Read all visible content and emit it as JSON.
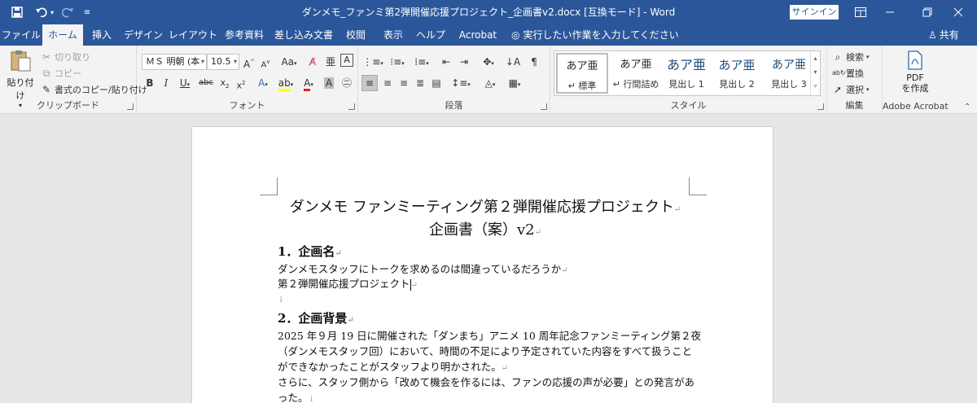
{
  "titlebar": {
    "save_icon": "save-icon",
    "undo_icon": "undo-icon",
    "redo_icon": "redo-icon",
    "customize_icon": "customize-qat-icon",
    "title": "ダンメモ_ファンミ第2弾開催応援プロジェクト_企画書v2.docx [互換モード]  -  Word",
    "signin": "サインイン",
    "ribbon_display_icon": "ribbon-display-icon",
    "minimize_icon": "minimize-icon",
    "restore_icon": "restore-icon",
    "close_icon": "close-icon",
    "accent": "#2b579a"
  },
  "tabs": [
    "ファイル",
    "ホーム",
    "挿入",
    "デザイン",
    "レイアウト",
    "参考資料",
    "差し込み文書",
    "校閲",
    "表示",
    "ヘルプ",
    "Acrobat"
  ],
  "active_tab": "ホーム",
  "tellme": "実行したい作業を入力してください",
  "share": "共有",
  "ribbon": {
    "clipboard": {
      "label": "クリップボード",
      "paste": "貼り付け",
      "cut": "切り取り",
      "copy": "コピー",
      "format_painter": "書式のコピー/貼り付け"
    },
    "font": {
      "label": "フォント",
      "font_name": "ＭＳ 明朝 (本",
      "font_size": "10.5"
    },
    "paragraph": {
      "label": "段落"
    },
    "styles": {
      "label": "スタイル",
      "items": [
        {
          "sample": "あア亜",
          "name": "標準"
        },
        {
          "sample": "あア亜",
          "name": "行間詰め"
        },
        {
          "sample": "あア亜",
          "name": "見出し 1"
        },
        {
          "sample": "あア亜",
          "name": "見出し 2"
        },
        {
          "sample": "あア亜",
          "name": "見出し 3"
        }
      ]
    },
    "editing": {
      "label": "編集",
      "find": "検索",
      "replace": "置換",
      "select": "選択"
    },
    "acrobat": {
      "label": "Adobe Acrobat",
      "pdf_line1": "PDF",
      "pdf_line2": "を作成"
    }
  },
  "document": {
    "title_line1": "ダンメモ ファンミーティング第２弾開催応援プロジェクト",
    "title_line2": "企画書（案）v2",
    "sec1_heading": "1．企画名",
    "sec1_line1": "ダンメモスタッフにトークを求めるのは間違っているだろうか",
    "sec1_line2": "第２弾開催応援プロジェクト",
    "sec2_heading": "2．企画背景",
    "sec2_line1": "2025 年９月 19 日に開催された「ダンまち」アニメ 10 周年記念ファンミーティング第２夜",
    "sec2_line2": "（ダンメモスタッフ回）において、時間の不足により予定されていた内容をすべて扱うこと",
    "sec2_line3": "ができなかったことがスタッフより明かされた。",
    "sec2_line4": "さらに、スタッフ側から「改めて機会を作るには、ファンの応援の声が必要」との発言があ",
    "sec2_line5": "った。",
    "para_mark": "↵",
    "line_mark": "↓"
  }
}
